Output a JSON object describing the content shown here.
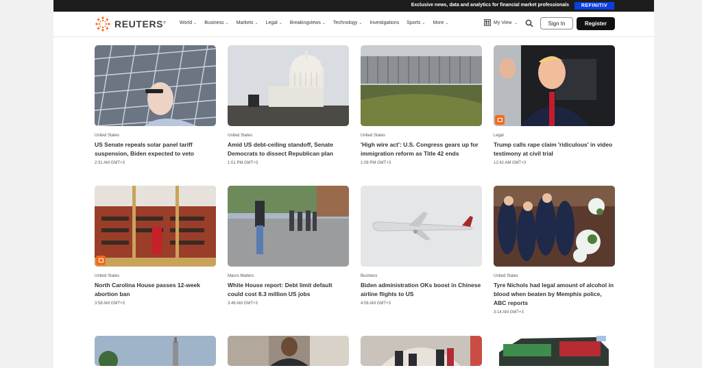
{
  "promo": {
    "text": "Exclusive news, data and analytics for financial market professionals",
    "badge": "REFINITIV"
  },
  "brand": {
    "name": "REUTERS",
    "mark": "®"
  },
  "nav": [
    {
      "label": "World"
    },
    {
      "label": "Business"
    },
    {
      "label": "Markets"
    },
    {
      "label": "Legal"
    },
    {
      "label": "Breakingviews"
    },
    {
      "label": "Technology"
    },
    {
      "label": "Investigations"
    },
    {
      "label": "Sports"
    },
    {
      "label": "More"
    }
  ],
  "header": {
    "my_view": "My View",
    "sign_in": "Sign In",
    "register": "Register"
  },
  "icons": [
    "logo-icon",
    "my-view-icon",
    "search-icon",
    "chevron-down-icon",
    "gallery-icon"
  ],
  "colors": {
    "accent": "#f26b1d",
    "promo_badge": "#0a3fe0",
    "register_button": "#111111"
  },
  "articles": [
    {
      "kicker": "United States",
      "headline": "US Senate repeals solar panel tariff suspension, Biden expected to veto",
      "time": "2:31 AM GMT+3"
    },
    {
      "kicker": "United States",
      "headline": "Amid US debt-ceiling standoff, Senate Democrats to dissect Republican plan",
      "time": "1:01 PM GMT+3"
    },
    {
      "kicker": "United States",
      "headline": "'High wire act': U.S. Congress gears up for immigration reform as Title 42 ends",
      "time": "1:08 PM GMT+3"
    },
    {
      "kicker": "Legal",
      "headline": "Trump calls rape claim 'ridiculous' in video testimony at civil trial",
      "time": "12:42 AM GMT+3"
    },
    {
      "kicker": "United States",
      "headline": "North Carolina House passes 12-week abortion ban",
      "time": "3:58 AM GMT+3"
    },
    {
      "kicker": "Macro Matters",
      "headline": "White House report: Debt limit default could cost 8.3 million US jobs",
      "time": "3:46 AM GMT+3"
    },
    {
      "kicker": "Business",
      "headline": "Biden administration OKs boost in Chinese airline flights to US",
      "time": "4:08 AM GMT+3"
    },
    {
      "kicker": "United States",
      "headline": "Tyre Nichols had legal amount of alcohol in blood when beaten by Memphis police, ABC reports",
      "time": "3:14 AM GMT+3"
    }
  ]
}
